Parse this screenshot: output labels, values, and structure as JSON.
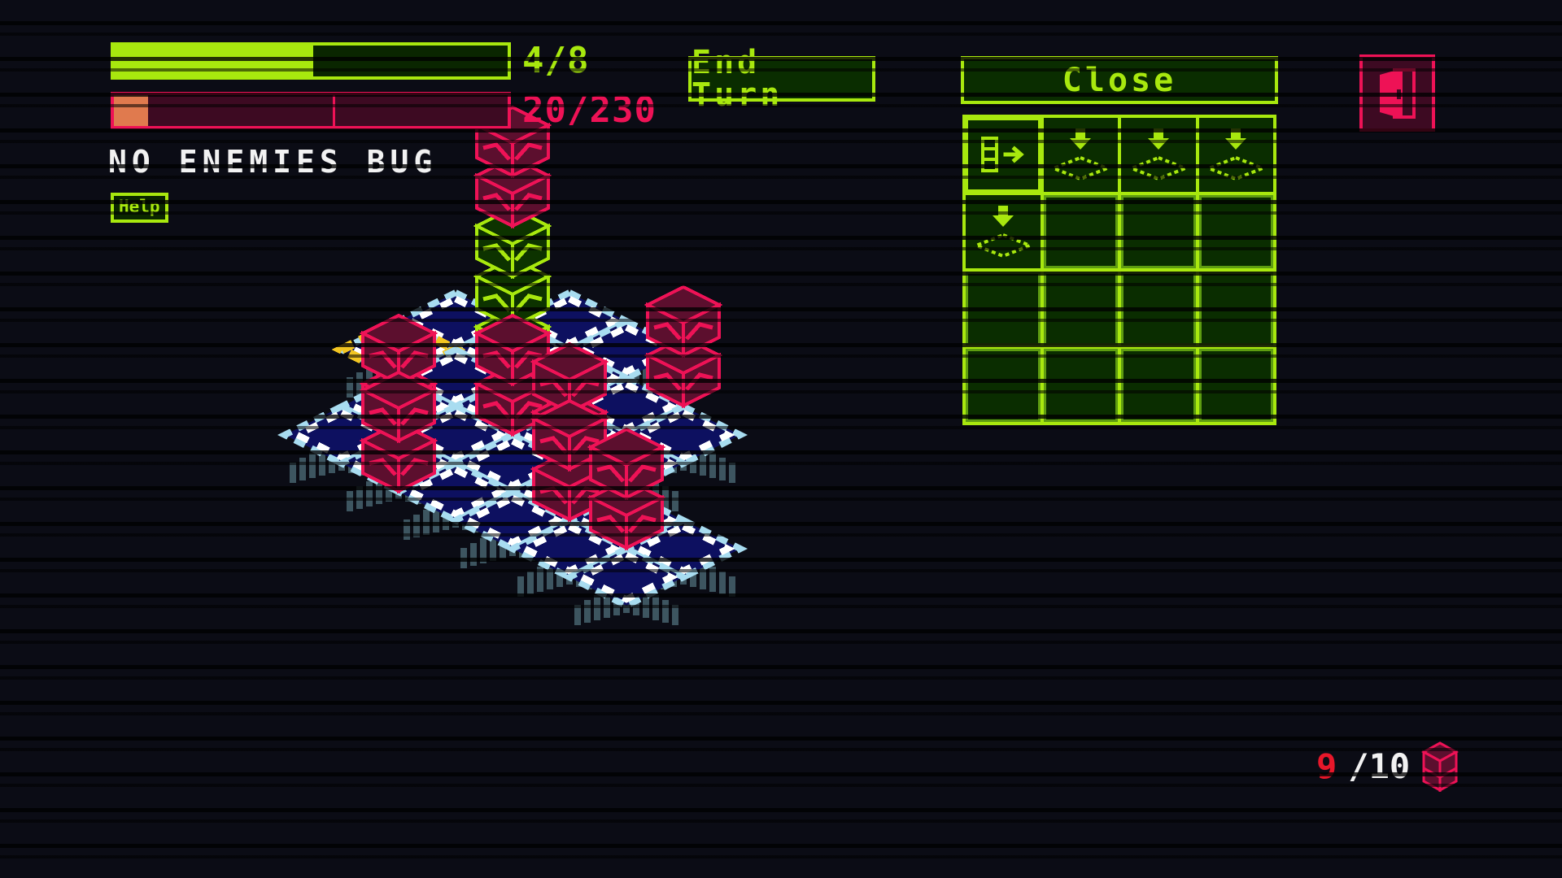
{
  "hud": {
    "action_points": {
      "label": "4/8",
      "current": 4,
      "max": 8,
      "segments": 2,
      "color": "#a8e80e"
    },
    "health": {
      "label": "20/230",
      "current": 20,
      "max": 230,
      "segments": 2,
      "color": "#ee1256",
      "fill_color": "#e07a4e"
    },
    "status_text": "NO ENEMIES BUG",
    "help_button": "Help"
  },
  "toolbar": {
    "end_turn_label": "End Turn",
    "close_label": "Close",
    "exit_icon": "door-icon"
  },
  "inventory": {
    "rows": 4,
    "cols": 4,
    "slots": [
      {
        "icon": "card-stack-arrow-right-icon",
        "filled": true,
        "selected": true
      },
      {
        "icon": "arrow-down-diamond-icon",
        "filled": true,
        "selected": false
      },
      {
        "icon": "arrow-down-diamond-icon",
        "filled": true,
        "selected": false
      },
      {
        "icon": "arrow-down-diamond-icon",
        "filled": true,
        "selected": false
      },
      {
        "icon": "arrow-down-diamond-icon",
        "filled": true,
        "selected": false
      },
      {
        "icon": "",
        "filled": false,
        "selected": false
      },
      {
        "icon": "",
        "filled": false,
        "selected": false
      },
      {
        "icon": "",
        "filled": false,
        "selected": false
      },
      {
        "icon": "",
        "filled": false,
        "selected": false
      },
      {
        "icon": "",
        "filled": false,
        "selected": false
      },
      {
        "icon": "",
        "filled": false,
        "selected": false
      },
      {
        "icon": "",
        "filled": false,
        "selected": false
      },
      {
        "icon": "",
        "filled": false,
        "selected": false
      },
      {
        "icon": "",
        "filled": false,
        "selected": false
      },
      {
        "icon": "",
        "filled": false,
        "selected": false
      },
      {
        "icon": "",
        "filled": false,
        "selected": false
      }
    ]
  },
  "enemy_counter": {
    "current": "9",
    "rest": "/10",
    "icon": "enemy-cube-icon"
  },
  "colors": {
    "background": "#0b0c15",
    "accent_green": "#a8e80e",
    "panel_green": "#0a2d00",
    "accent_pink": "#ee1256",
    "tile_fill": "#0d1060",
    "tile_edge": "#a8dcf0",
    "tile_edge_white": "#ffffff",
    "tile_leg": "#3d5560",
    "highlight_yellow": "#f2c521",
    "enemy_dark": "#5c0f2e",
    "player_dark": "#0d3300"
  },
  "board": {
    "tiles": [
      {
        "c": 0,
        "r": 0
      },
      {
        "c": 1,
        "r": 0
      },
      {
        "c": -1,
        "r": 1
      },
      {
        "c": 0,
        "r": 1
      },
      {
        "c": 1,
        "r": 1
      },
      {
        "c": 2,
        "r": 1
      },
      {
        "c": 3,
        "r": 1
      },
      {
        "c": -1,
        "r": 2
      },
      {
        "c": 0,
        "r": 2
      },
      {
        "c": 1,
        "r": 2
      },
      {
        "c": 2,
        "r": 2
      },
      {
        "c": 3,
        "r": 2
      },
      {
        "c": 0,
        "r": 3
      },
      {
        "c": 1,
        "r": 3
      },
      {
        "c": 2,
        "r": 3
      },
      {
        "c": 3,
        "r": 3
      },
      {
        "c": 4,
        "r": 3
      },
      {
        "c": 5,
        "r": 3
      },
      {
        "c": 0,
        "r": 4
      },
      {
        "c": 1,
        "r": 4
      },
      {
        "c": 2,
        "r": 4
      },
      {
        "c": 3,
        "r": 4
      },
      {
        "c": 4,
        "r": 4
      },
      {
        "c": 5,
        "r": 4
      }
    ],
    "highlight_tile": {
      "c": -1,
      "r": 2
    },
    "player": {
      "c": 0,
      "r": 1,
      "height": 3,
      "stacked_enemies": 2
    },
    "enemies": [
      {
        "c": 2,
        "r": 0,
        "height": 2
      },
      {
        "c": 1,
        "r": 2,
        "height": 2
      },
      {
        "c": 2,
        "r": 2,
        "height": 2
      },
      {
        "c": 0,
        "r": 3,
        "height": 2
      },
      {
        "c": 1,
        "r": 4,
        "height": 2
      },
      {
        "c": 3,
        "r": 3,
        "height": 2
      },
      {
        "c": 4,
        "r": 3,
        "height": 2
      }
    ]
  }
}
